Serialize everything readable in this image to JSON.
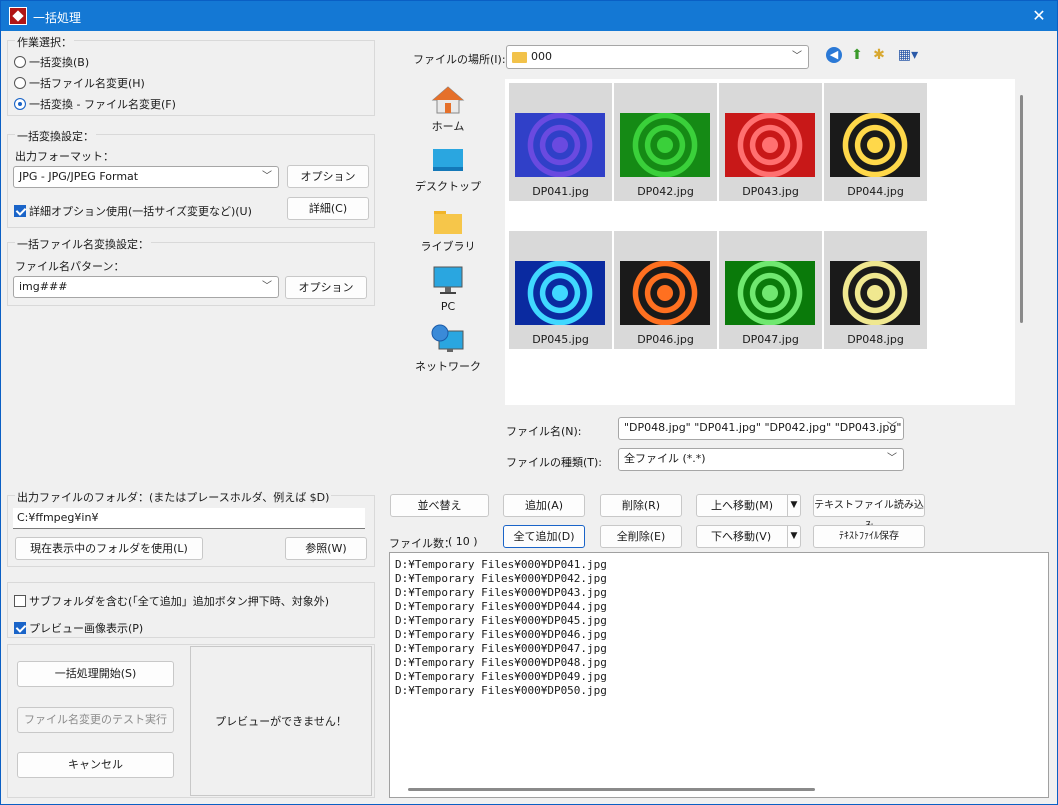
{
  "window": {
    "title": "一括処理"
  },
  "mode": {
    "label": "作業選択：",
    "options": [
      {
        "label": "一括変換(B)",
        "checked": false
      },
      {
        "label": "一括ファイル名変更(H)",
        "checked": false
      },
      {
        "label": "一括変換 - ファイル名変更(F)",
        "checked": true
      }
    ]
  },
  "convert": {
    "label": "一括変換設定：",
    "format_label": "出力フォーマット：",
    "format_value": "JPG - JPG/JPEG Format",
    "option_button": "オプション",
    "detail_checkbox": "詳細オプション使用(一括サイズ変更など)(U)",
    "detail_button": "詳細(C)"
  },
  "rename": {
    "label": "一括ファイル名変換設定：",
    "pattern_label": "ファイル名パターン：",
    "pattern_value": "img###",
    "option_button": "オプション"
  },
  "output": {
    "label": "出力ファイルのフォルダ：(またはプレースホルダ、例えば $D)",
    "path": "C:¥ffmpeg¥in¥",
    "use_current_button": "現在表示中のフォルダを使用(L)",
    "browse_button": "参照(W)"
  },
  "options": {
    "subfolder": "サブフォルダを含む(「全て追加」追加ボタン押下時、対象外)",
    "preview": "プレビュー画像表示(P)"
  },
  "actions": {
    "start": "一括処理開始(S)",
    "test": "ファイル名変更のテスト実行",
    "cancel": "キャンセル"
  },
  "preview_text": "プレビューができません！",
  "browser": {
    "location_label": "ファイルの場所(I):",
    "location_value": "000",
    "places": [
      "ホーム",
      "デスクトップ",
      "ライブラリ",
      "PC",
      "ネットワーク"
    ],
    "files": [
      {
        "name": "DP041.jpg",
        "colors": [
          "#6a4ae0",
          "#3040c8"
        ]
      },
      {
        "name": "DP042.jpg",
        "colors": [
          "#3ad03a",
          "#158a15"
        ]
      },
      {
        "name": "DP043.jpg",
        "colors": [
          "#ff7070",
          "#c81818"
        ]
      },
      {
        "name": "DP044.jpg",
        "colors": [
          "#ffd84a",
          "#1a1a1a"
        ]
      },
      {
        "name": "DP045.jpg",
        "colors": [
          "#40d8ff",
          "#0a2aa0"
        ]
      },
      {
        "name": "DP046.jpg",
        "colors": [
          "#ff7020",
          "#1a1a1a"
        ]
      },
      {
        "name": "DP047.jpg",
        "colors": [
          "#70e870",
          "#0a7a0a"
        ]
      },
      {
        "name": "DP048.jpg",
        "colors": [
          "#f0e890",
          "#1a1a1a"
        ]
      }
    ],
    "filename_label": "ファイル名(N):",
    "filename_value": "\"DP048.jpg\" \"DP041.jpg\" \"DP042.jpg\" \"DP043.jpg\"",
    "filetype_label": "ファイルの種類(T):",
    "filetype_value": "全ファイル (*.*)"
  },
  "list_buttons": {
    "sort": "並べ替え",
    "add": "追加(A)",
    "remove": "削除(R)",
    "move_up": "上へ移動(M)",
    "load_text": "テキストファイル読み込み",
    "add_all": "全て追加(D)",
    "remove_all": "全削除(E)",
    "move_down": "下へ移動(V)",
    "save_text": "ﾃｷｽﾄﾌｧｲﾙ保存"
  },
  "file_count": {
    "label": "ファイル数：",
    "value": "( 10 )"
  },
  "file_list": [
    "D:¥Temporary Files¥000¥DP041.jpg",
    "D:¥Temporary Files¥000¥DP042.jpg",
    "D:¥Temporary Files¥000¥DP043.jpg",
    "D:¥Temporary Files¥000¥DP044.jpg",
    "D:¥Temporary Files¥000¥DP045.jpg",
    "D:¥Temporary Files¥000¥DP046.jpg",
    "D:¥Temporary Files¥000¥DP047.jpg",
    "D:¥Temporary Files¥000¥DP048.jpg",
    "D:¥Temporary Files¥000¥DP049.jpg",
    "D:¥Temporary Files¥000¥DP050.jpg"
  ]
}
